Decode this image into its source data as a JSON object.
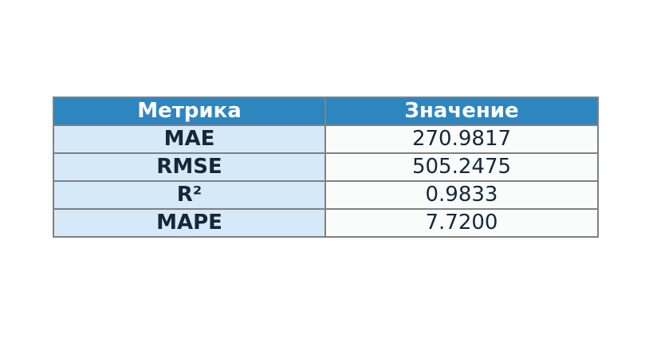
{
  "chart_data": {
    "type": "table",
    "columns": [
      "Метрика",
      "Значение"
    ],
    "rows": [
      [
        "MAE",
        "270.9817"
      ],
      [
        "RMSE",
        "505.2475"
      ],
      [
        "R²",
        "0.9833"
      ],
      [
        "MAPE",
        "7.7200"
      ]
    ],
    "colors": {
      "header_bg": "#2e86c1",
      "header_text": "#ffffff",
      "metric_col_bg": "#d6e9f8",
      "value_col_bg": "#fafcfc",
      "border": "#808080",
      "text": "#17273a"
    }
  }
}
